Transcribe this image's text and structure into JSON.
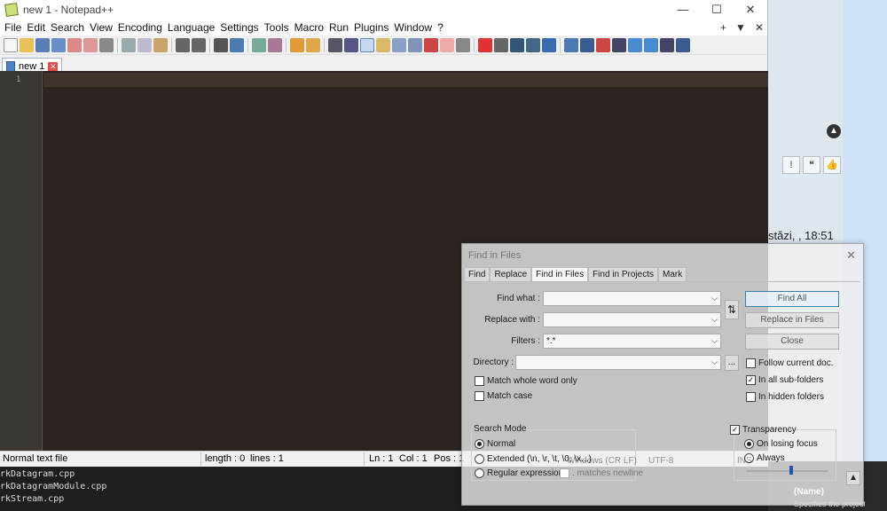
{
  "window": {
    "title": "new 1 - Notepad++",
    "controls": [
      "—",
      "☐",
      "✕"
    ]
  },
  "menu": {
    "items": [
      "File",
      "Edit",
      "Search",
      "View",
      "Encoding",
      "Language",
      "Settings",
      "Tools",
      "Macro",
      "Run",
      "Plugins",
      "Window",
      "?"
    ],
    "right_controls": [
      "+",
      "▼",
      "✕"
    ]
  },
  "tab": {
    "label": "new 1"
  },
  "editor": {
    "line_number": "1"
  },
  "status": {
    "file_type": "Normal text file",
    "length": "length : 0",
    "lines": "lines : 1",
    "ln": "Ln : 1",
    "col": "Col : 1",
    "pos": "Pos : 1"
  },
  "dialog": {
    "title": "Find in Files",
    "close": "✕",
    "tabs": [
      "Find",
      "Replace",
      "Find in Files",
      "Find in Projects",
      "Mark"
    ],
    "find_what_label": "Find what :",
    "replace_with_label": "Replace with :",
    "filters_label": "Filters :",
    "filters_value": "*.*",
    "directory_label": "Directory :",
    "browse": "...",
    "swap": "⇅",
    "buttons": {
      "find_all": "Find All",
      "replace_in_files": "Replace in Files",
      "close": "Close"
    },
    "checks": {
      "follow_current_doc": "Follow current doc.",
      "in_all_sub_folders": "In all sub-folders",
      "in_hidden_folders": "In hidden folders",
      "match_whole_word": "Match whole word only",
      "match_case": "Match case"
    },
    "search_mode": {
      "label": "Search Mode",
      "normal": "Normal",
      "extended": "Extended (\\n, \\r, \\t, \\0, \\x...)",
      "regex": "Regular expression",
      "matches_newline": ". matches newline"
    },
    "transparency": {
      "label": "Transparency",
      "on_losing_focus": "On losing focus",
      "always": "Always",
      "level": 0.55
    },
    "ghost_text": {
      "eol": "Windows (CR LF)",
      "encoding": "UTF-8",
      "ins": "INS"
    }
  },
  "background": {
    "console_lines": [
      "rkDatagram.cpp",
      "rkDatagramModule.cpp",
      "rkStream.cpp"
    ],
    "timestamp": "stăzi, , 18:51",
    "props_name": "(Name)",
    "props_desc": "Specifies the project nar",
    "scroll_up": "▲"
  }
}
